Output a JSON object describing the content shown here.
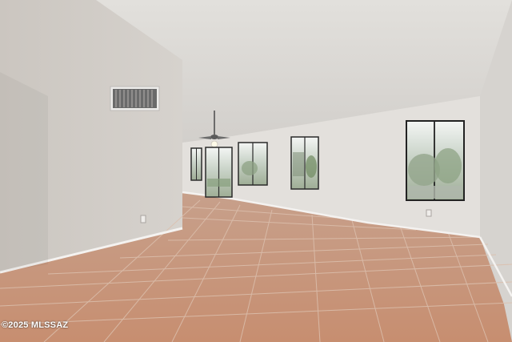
{
  "watermark": {
    "text": "©2025 MLSSAZ"
  },
  "scene": {
    "description_tags": [
      "room",
      "tile-floor",
      "ceiling-fan",
      "windows",
      "sliding-door",
      "air-vent"
    ],
    "colors": {
      "ceiling": "#dcd9d5",
      "left_wall": "#cfcac4",
      "back_wall": "#e3e0dc",
      "right_wall": "#d8d5d1",
      "floor": "#c9967a",
      "grout": "#d9b8a4",
      "baseboard": "#f2f0ee",
      "window_frame": "#2a2a2a",
      "outdoor": "#b9c4b3"
    }
  }
}
